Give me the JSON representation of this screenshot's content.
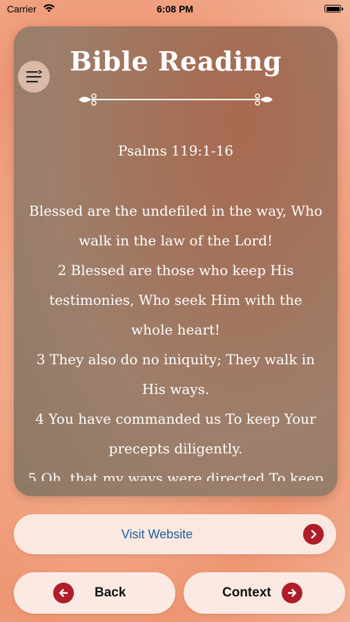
{
  "status_bar": {
    "carrier": "Carrier",
    "time": "6:08 PM"
  },
  "card": {
    "title": "Bible Reading",
    "reference": "Psalms 119:1-16",
    "verses": [
      "Blessed are the undefiled in the way, Who walk in the law of the Lord!",
      "2  Blessed are those who keep His testimonies, Who seek Him with the whole heart!",
      "3  They also do no iniquity; They walk in His ways.",
      "4  You have commanded us To keep Your precepts diligently.",
      "5  Oh, that my ways were directed To keep"
    ]
  },
  "buttons": {
    "visit_website": "Visit Website",
    "back": "Back",
    "context": "Context"
  },
  "icons": {
    "menu": "menu-icon",
    "wifi": "wifi-icon",
    "battery": "battery-icon",
    "chevron_right": "chevron-right-icon",
    "arrow_left": "arrow-left-icon",
    "arrow_right": "arrow-right-icon"
  },
  "colors": {
    "accent": "#b01c2a",
    "link": "#1f5fa0"
  }
}
